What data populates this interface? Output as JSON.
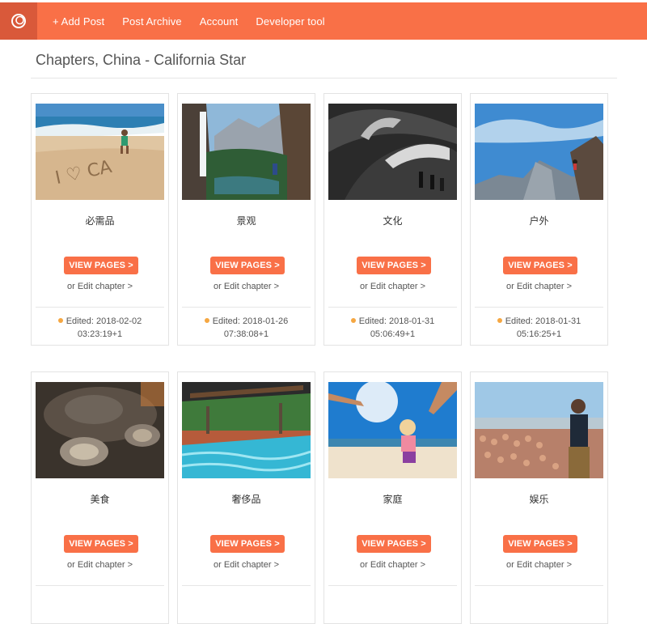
{
  "nav": {
    "items": [
      {
        "label": "+ Add Post"
      },
      {
        "label": "Post Archive"
      },
      {
        "label": "Account"
      },
      {
        "label": "Developer tool"
      }
    ]
  },
  "page": {
    "title": "Chapters, China - California Star"
  },
  "colors": {
    "accent": "#f97047",
    "accent_dark": "#d9593a",
    "status_dot": "#f5a742"
  },
  "cards": [
    {
      "title": "必需品",
      "button": "VIEW PAGES >",
      "edit": "or Edit chapter >",
      "edited_line1": "Edited: 2018-02-02",
      "edited_line2": "03:23:19+1",
      "image": "beach-sand-writing"
    },
    {
      "title": "景观",
      "button": "VIEW PAGES >",
      "edit": "or Edit chapter >",
      "edited_line1": "Edited: 2018-01-26",
      "edited_line2": "07:38:08+1",
      "image": "waterfall-valley"
    },
    {
      "title": "文化",
      "button": "VIEW PAGES >",
      "edit": "or Edit chapter >",
      "edited_line1": "Edited: 2018-01-31",
      "edited_line2": "05:06:49+1",
      "image": "museum-interior"
    },
    {
      "title": "户外",
      "button": "VIEW PAGES >",
      "edit": "or Edit chapter >",
      "edited_line1": "Edited: 2018-01-31",
      "edited_line2": "05:16:25+1",
      "image": "rock-climber-sky"
    },
    {
      "title": "美食",
      "button": "VIEW PAGES >",
      "edit": "or Edit chapter >",
      "image": "oysters"
    },
    {
      "title": "奢侈品",
      "button": "VIEW PAGES >",
      "edit": "or Edit chapter >",
      "image": "pool-resort"
    },
    {
      "title": "家庭",
      "button": "VIEW PAGES >",
      "edit": "or Edit chapter >",
      "image": "child-swing-beach"
    },
    {
      "title": "娱乐",
      "button": "VIEW PAGES >",
      "edit": "or Edit chapter >",
      "image": "concert-crowd"
    }
  ]
}
